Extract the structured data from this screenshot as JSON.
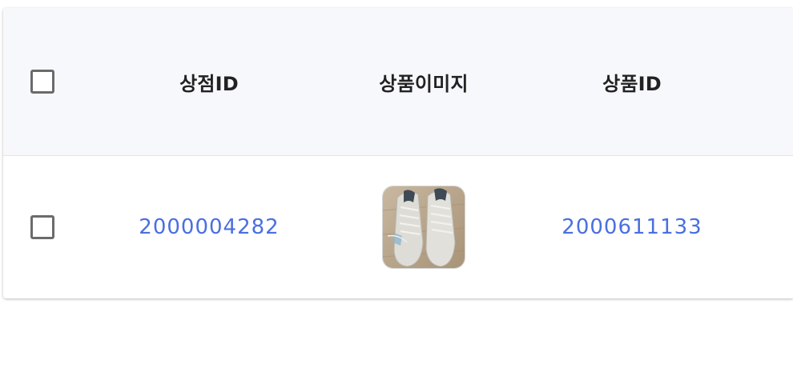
{
  "table": {
    "columns": [
      {
        "key": "select",
        "label": ""
      },
      {
        "key": "store_id",
        "label": "상점ID"
      },
      {
        "key": "product_image",
        "label": "상품이미지"
      },
      {
        "key": "product_id",
        "label": "상품ID"
      }
    ],
    "rows": [
      {
        "selected": false,
        "store_id": "2000004282",
        "product_image": "shoe-thumbnail",
        "product_id": "2000611133"
      }
    ],
    "header_all_selected": false
  },
  "colors": {
    "link": "#4a6fe0",
    "header_bg": "#f7f8fb",
    "checkbox_border": "#6b6b6b"
  }
}
